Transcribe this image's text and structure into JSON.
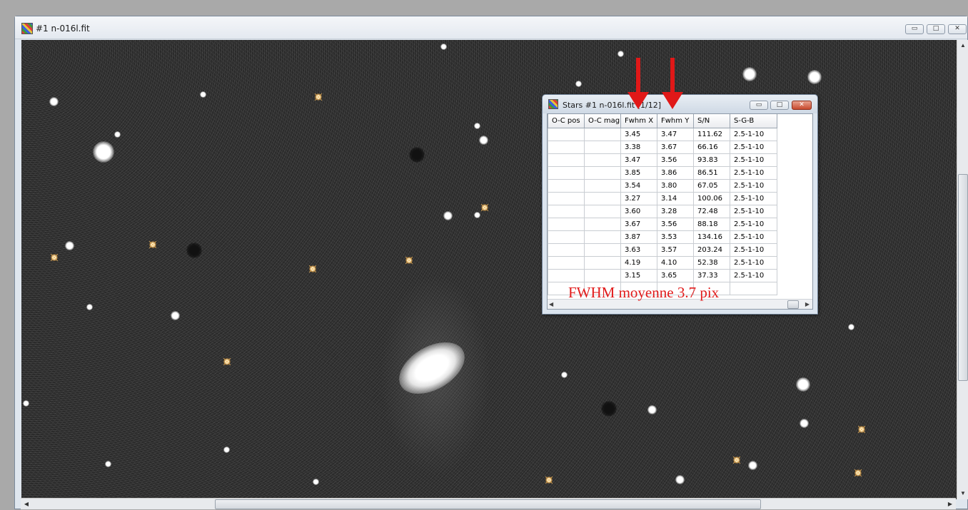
{
  "main_window": {
    "title": "#1 n-016l.fit",
    "icon": "palette-icon",
    "controls": {
      "minimize": "▭",
      "maximize": "□",
      "close": "✕"
    }
  },
  "stars_window": {
    "title": "Stars #1 n-016l.fit  [1/12]",
    "icon": "palette-icon",
    "controls": {
      "minimize": "▭",
      "maximize": "□",
      "close": "✕"
    },
    "columns": [
      "O-C pos",
      "O-C mag",
      "Fwhm X",
      "Fwhm Y",
      "S/N",
      "S-G-B"
    ],
    "rows": [
      [
        "",
        "",
        "3.45",
        "3.47",
        "111.62",
        "2.5-1-10"
      ],
      [
        "",
        "",
        "3.38",
        "3.67",
        "66.16",
        "2.5-1-10"
      ],
      [
        "",
        "",
        "3.47",
        "3.56",
        "93.83",
        "2.5-1-10"
      ],
      [
        "",
        "",
        "3.85",
        "3.86",
        "86.51",
        "2.5-1-10"
      ],
      [
        "",
        "",
        "3.54",
        "3.80",
        "67.05",
        "2.5-1-10"
      ],
      [
        "",
        "",
        "3.27",
        "3.14",
        "100.06",
        "2.5-1-10"
      ],
      [
        "",
        "",
        "3.60",
        "3.28",
        "72.48",
        "2.5-1-10"
      ],
      [
        "",
        "",
        "3.67",
        "3.56",
        "88.18",
        "2.5-1-10"
      ],
      [
        "",
        "",
        "3.87",
        "3.53",
        "134.16",
        "2.5-1-10"
      ],
      [
        "",
        "",
        "3.63",
        "3.57",
        "203.24",
        "2.5-1-10"
      ],
      [
        "",
        "",
        "4.19",
        "4.10",
        "52.38",
        "2.5-1-10"
      ],
      [
        "",
        "",
        "3.15",
        "3.65",
        "37.33",
        "2.5-1-10"
      ]
    ]
  },
  "annotation": {
    "text": "FWHM moyenne 3.7 pix",
    "color": "#e11b1b"
  },
  "colors": {
    "annotation_red": "#e01818",
    "sky_background": "#2a2a2a"
  }
}
